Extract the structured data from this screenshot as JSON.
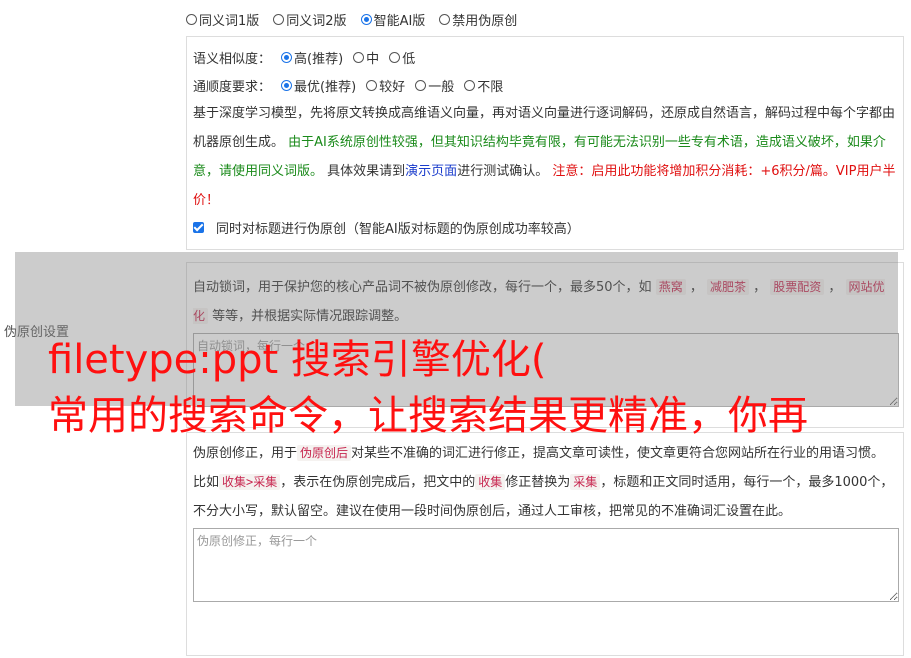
{
  "version_options": [
    {
      "label": "同义词1版",
      "selected": false
    },
    {
      "label": "同义词2版",
      "selected": false
    },
    {
      "label": "智能AI版",
      "selected": true
    },
    {
      "label": "禁用伪原创",
      "selected": false
    }
  ],
  "similarity": {
    "label": "语义相似度：",
    "options": [
      {
        "label": "高(推荐)",
        "selected": true
      },
      {
        "label": "中",
        "selected": false
      },
      {
        "label": "低",
        "selected": false
      }
    ]
  },
  "fluency": {
    "label": "通顺度要求：",
    "options": [
      {
        "label": "最优(推荐)",
        "selected": true
      },
      {
        "label": "较好",
        "selected": false
      },
      {
        "label": "一般",
        "selected": false
      },
      {
        "label": "不限",
        "selected": false
      }
    ]
  },
  "desc": {
    "part1": "基于深度学习模型，先将原文转换成高维语义向量，再对语义向量进行逐词解码，还原成自然语言，解码过程中每个字都由机器原创生成。",
    "part2": "由于AI系统原创性较强，但其知识结构毕竟有限，有可能无法识别一些专有术语，造成语义破坏，如果介意，请使用同义词版。",
    "part3": "具体效果请到",
    "demo_link": "演示页面",
    "part4": "进行测试确认。",
    "warning": "注意：启用此功能将增加积分消耗：+6积分/篇。VIP用户半价！"
  },
  "title_checkbox": {
    "label": "同时对标题进行伪原创（智能AI版对标题的伪原创成功率较高）",
    "checked": true
  },
  "side_label": "伪原创设置",
  "lock_words": {
    "intro": "自动锁词，用于保护您的核心产品词不被伪原创修改，每行一个，最多50个，如",
    "examples": [
      "燕窝",
      "减肥茶",
      "股票配资",
      "网站优化"
    ],
    "outro": "等等，并根据实际情况跟踪调整。",
    "placeholder": "自动锁词，每行一个"
  },
  "correction": {
    "intro": "伪原创修正，用于",
    "code1": "伪原创后",
    "text2": "对某些不准确的词汇进行修正，提高文章可读性，使文章更符合您网站所在行业的用语习惯。比如",
    "code2": "收集>采集",
    "text3": "，表示在伪原创完成后，把文中的",
    "code3": "收集",
    "text4": "修正替换为",
    "code4": "采集",
    "text5": "，标题和正文同时适用，每行一个，最多1000个，不分大小写，默认留空。建议在使用一段时间伪原创后，通过人工审核，把常见的不准确词汇设置在此。",
    "placeholder": "伪原创修正，每行一个"
  },
  "overlay": {
    "line1": "filetype:ppt 搜索引擎优化(",
    "line2": "常用的搜索命令，让搜索结果更精准，你再"
  }
}
